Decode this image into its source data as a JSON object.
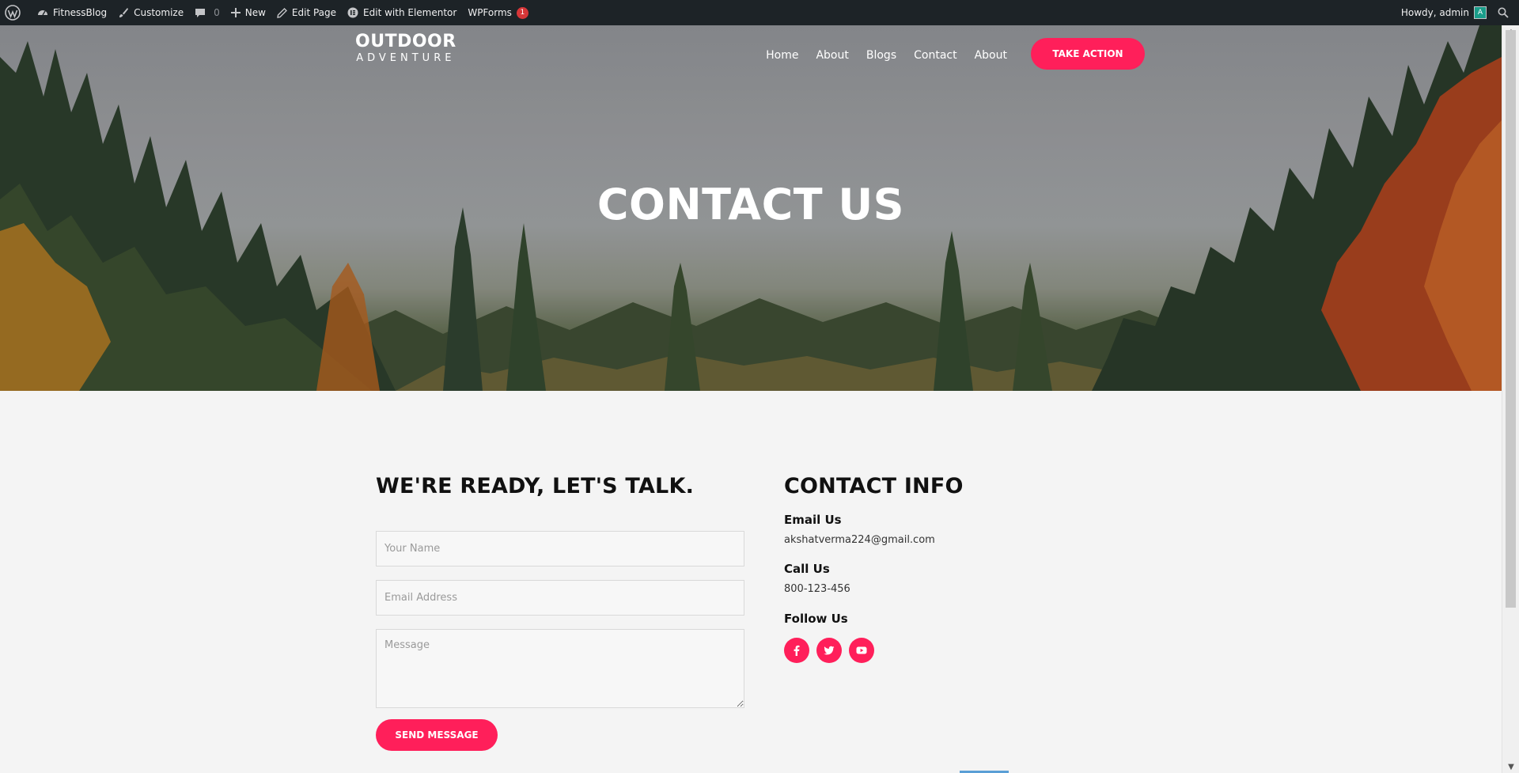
{
  "admin_bar": {
    "site_name": "FitnessBlog",
    "customize": "Customize",
    "comments_count": "0",
    "new": "New",
    "edit_page": "Edit Page",
    "edit_elementor": "Edit with Elementor",
    "wpforms": "WPForms",
    "wpforms_badge": "1",
    "howdy": "Howdy, admin",
    "avatar_letter": "A"
  },
  "header": {
    "logo_line1": "OUTDOOR",
    "logo_line2": "ADVENTURE",
    "nav": [
      "Home",
      "About",
      "Blogs",
      "Contact",
      "About"
    ],
    "cta": "TAKE ACTION"
  },
  "hero": {
    "title": "CONTACT US"
  },
  "form": {
    "heading": "WE'RE READY, LET'S TALK.",
    "name_placeholder": "Your Name",
    "email_placeholder": "Email Address",
    "message_placeholder": "Message",
    "submit": "SEND MESSAGE"
  },
  "contact_info": {
    "heading": "CONTACT INFO",
    "email_label": "Email Us",
    "email": "akshatverma224@gmail.com",
    "call_label": "Call Us",
    "phone": "800-123-456",
    "follow_label": "Follow Us",
    "socials": [
      "facebook-icon",
      "twitter-icon",
      "youtube-icon"
    ]
  },
  "colors": {
    "accent": "#ff1f5a",
    "admin_bar": "#1d2327",
    "content_bg": "#f4f4f4"
  }
}
